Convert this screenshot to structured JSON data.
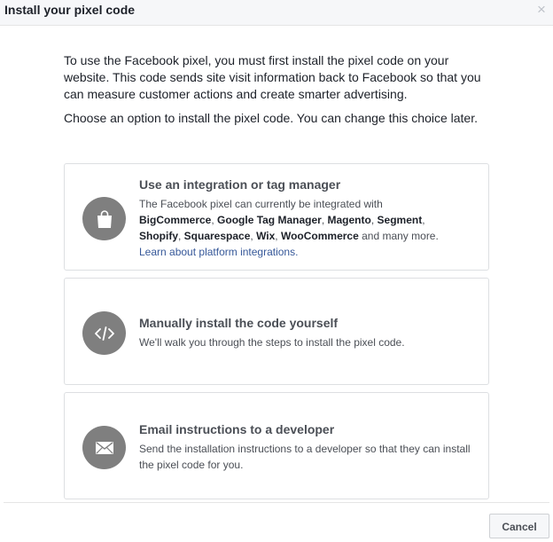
{
  "header": {
    "title": "Install your pixel code",
    "close_glyph": "×"
  },
  "intro": {
    "paragraph1": "To use the Facebook pixel, you must first install the pixel code on your website. This code sends site visit information back to Facebook so that you can measure customer actions and create smarter advertising.",
    "paragraph2": "Choose an option to install the pixel code. You can change this choice later."
  },
  "options": [
    {
      "icon": "shopping-bag-icon",
      "title": "Use an integration or tag manager",
      "desc_prefix": "The Facebook pixel can currently be integrated with",
      "platforms": [
        "BigCommerce",
        "Google Tag Manager",
        "Magento",
        "Segment",
        "Shopify",
        "Squarespace",
        "Wix",
        "WooCommerce"
      ],
      "desc_suffix": "and many more.",
      "link": "Learn about platform integrations."
    },
    {
      "icon": "code-icon",
      "title": "Manually install the code yourself",
      "desc": "We'll walk you through the steps to install the pixel code."
    },
    {
      "icon": "envelope-icon",
      "title": "Email instructions to a developer",
      "desc": "Send the installation instructions to a developer so that they can install the pixel code for you."
    }
  ],
  "footer": {
    "cancel_label": "Cancel"
  },
  "colors": {
    "icon_circle": "#7f7f7f",
    "link": "#365899",
    "header_bg": "#f6f7f9"
  }
}
